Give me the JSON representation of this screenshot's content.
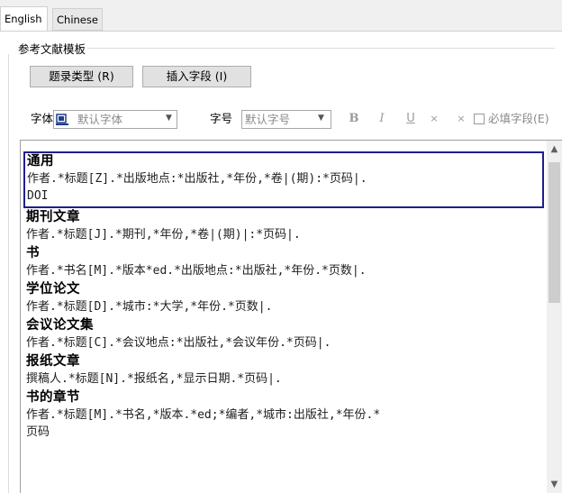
{
  "tabs": [
    "English",
    "Chinese"
  ],
  "group_title": "参考文献模板",
  "buttons": {
    "type_label": "题录类型 (R)",
    "insert_label": "插入字段 (I)"
  },
  "format": {
    "font_label": "字体",
    "font_value": "默认字体",
    "size_label": "字号",
    "size_value": "默认字号",
    "bold": "B",
    "italic": "I",
    "underline": "U",
    "superscript": "×",
    "subscript": "×",
    "required_label": "必填字段(E)"
  },
  "entries": [
    {
      "title": "通用",
      "text": "作者.*标题[Z].*出版地点:*出版社,*年份,*卷|(期):*页码|.\nDOI"
    },
    {
      "title": "期刊文章",
      "text": "作者.*标题[J].*期刊,*年份,*卷|(期)|:*页码|."
    },
    {
      "title": "书",
      "text": "作者.*书名[M].*版本*ed.*出版地点:*出版社,*年份.*页数|."
    },
    {
      "title": "学位论文",
      "text": "作者.*标题[D].*城市:*大学,*年份.*页数|."
    },
    {
      "title": "会议论文集",
      "text": "作者.*标题[C].*会议地点:*出版社,*会议年份.*页码|."
    },
    {
      "title": "报纸文章",
      "text": "撰稿人.*标题[N].*报纸名,*显示日期.*页码|."
    },
    {
      "title": "书的章节",
      "text": "作者.*标题[M].*书名,*版本.*ed;*编者,*城市:出版社,*年份.*\n页码"
    }
  ]
}
